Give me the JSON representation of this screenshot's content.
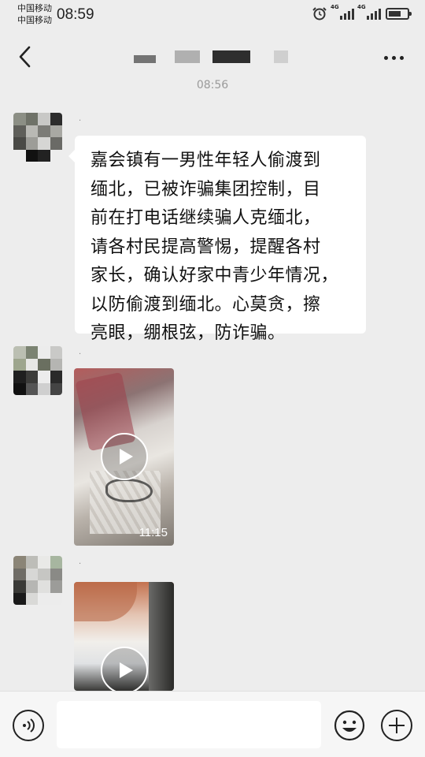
{
  "status_bar": {
    "carrier_1": "中国移动",
    "carrier_2": "中国移动",
    "time": "08:59",
    "network_1": "4G",
    "network_2": "4G",
    "icons": [
      "alarm-icon",
      "signal-icon",
      "signal-icon",
      "battery-icon"
    ]
  },
  "nav": {
    "back_icon": "chevron-left-icon",
    "title": "",
    "more_icon": "more-dots-icon"
  },
  "timestamp": "08:56",
  "messages": [
    {
      "type": "text",
      "sender_name": "·",
      "text": "嘉会镇有一男性年轻人偷渡到\n缅北，已被诈骗集团控制，目\n前在打电话继续骗人克缅北，\n请各村民提高警惕，提醒各村\n家长，确认好家中青少年情况，\n以防偷渡到缅北。心莫贪，擦\n亮眼，绷根弦，防诈骗。"
    },
    {
      "type": "video",
      "sender_name": "·",
      "duration": "11:15"
    },
    {
      "type": "video",
      "sender_name": "·",
      "duration": ""
    }
  ],
  "input_bar": {
    "voice_icon": "voice-icon",
    "input_value": "",
    "emoji_icon": "emoji-icon",
    "plus_icon": "plus-icon"
  },
  "colors": {
    "background": "#ededed",
    "bubble": "#ffffff",
    "input_bar": "#f6f6f6"
  }
}
